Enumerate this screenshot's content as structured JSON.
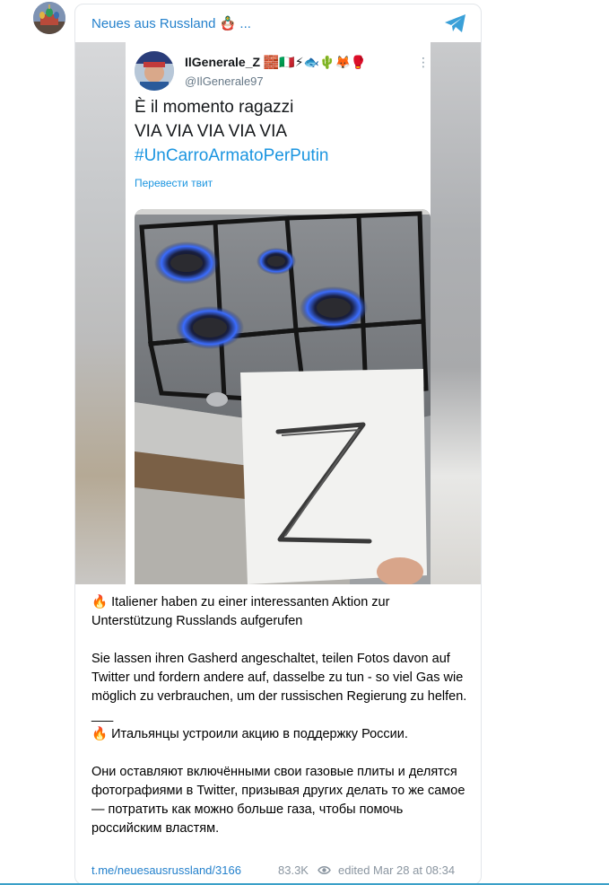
{
  "channel": {
    "name": "Neues aus Russland 🪆 ...",
    "avatar_icon": "kremlin-cathedral-avatar",
    "accent_color": "#2481cc"
  },
  "tweet": {
    "display_name": "IlGenerale_Z 🧱🇮🇹⚡🐟🌵🦊🥊",
    "handle": "@IlGenerale97",
    "more_icon": "more-vertical-icon",
    "line1": "È il momento ragazzi",
    "line2": "VIA VIA VIA VIA VIA",
    "hashtag": "#UnCarroArmatoPerPutin",
    "translate_label": "Перевести твит",
    "paper_letter": "Z"
  },
  "post": {
    "p1_emoji": "🔥",
    "p1_text": "Italiener haben zu einer interessanten Aktion zur Unterstützung Russlands aufgerufen",
    "p2_text": "Sie lassen ihren Gasherd angeschaltet, teilen Fotos davon auf Twitter und fordern andere auf, dasselbe zu tun - so viel Gas wie möglich zu verbrauchen, um der russischen Regierung zu helfen.",
    "separator": "___",
    "p3_emoji": "🔥",
    "p3_text": "Итальянцы устроили акцию в поддержку России.",
    "p4_text": "Они оставляют включёнными свои газовые плиты и делятся фотографиями в Twitter, призывая других делать то же самое — потратить как можно больше газа, чтобы помочь российским властям."
  },
  "footer": {
    "link": "t.me/neuesausrussland/3166",
    "views": "83.3K",
    "edited": "edited",
    "date": "Mar 28 at 08:34"
  }
}
